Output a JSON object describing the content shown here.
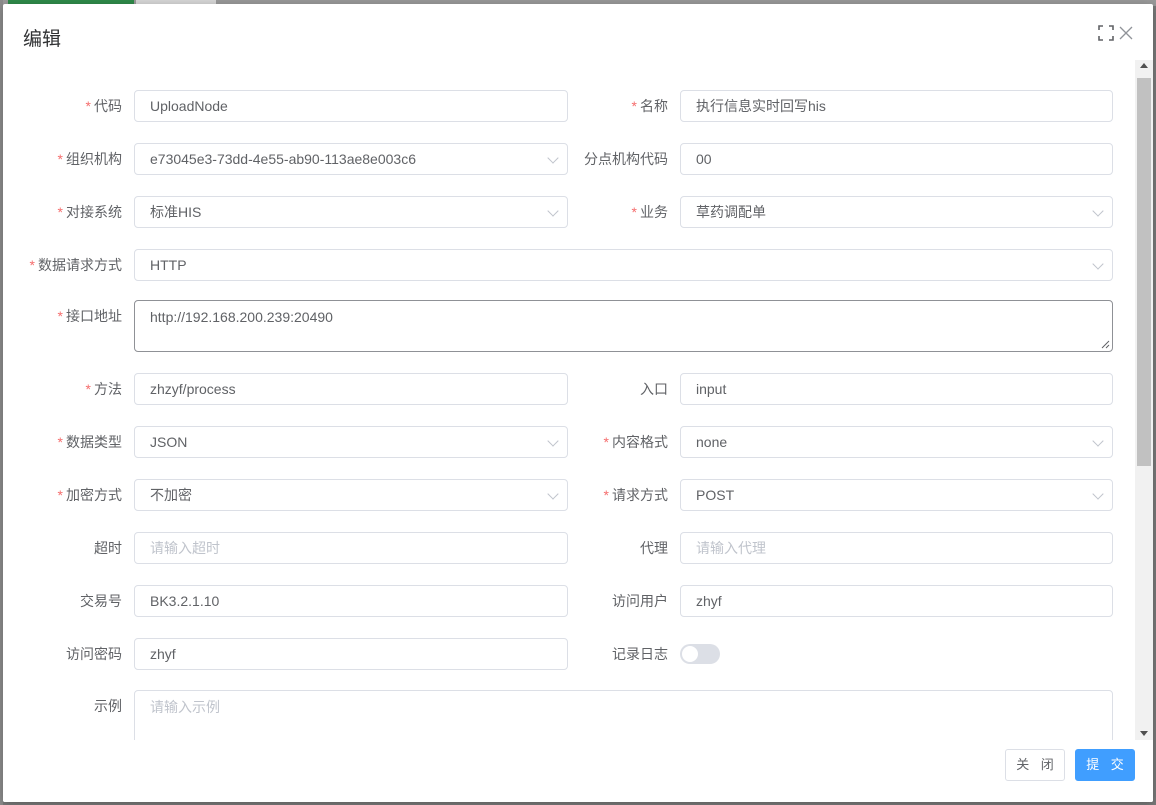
{
  "dialog": {
    "title": "编辑",
    "buttons": {
      "close": "关 闭",
      "submit": "提 交"
    }
  },
  "form": {
    "code": {
      "label": "代码",
      "value": "UploadNode"
    },
    "name": {
      "label": "名称",
      "value": "执行信息实时回写his"
    },
    "org": {
      "label": "组织机构",
      "value": "e73045e3-73dd-4e55-ab90-113ae8e003c6"
    },
    "branch_code": {
      "label": "分点机构代码",
      "value": "00"
    },
    "system": {
      "label": "对接系统",
      "value": "标准HIS"
    },
    "business": {
      "label": "业务",
      "value": "草药调配单"
    },
    "request_mode": {
      "label": "数据请求方式",
      "value": "HTTP"
    },
    "endpoint": {
      "label": "接口地址",
      "value": "http://192.168.200.239:20490"
    },
    "method": {
      "label": "方法",
      "value": "zhzyf/process"
    },
    "entry": {
      "label": "入口",
      "value": "input"
    },
    "data_type": {
      "label": "数据类型",
      "value": "JSON"
    },
    "content_format": {
      "label": "内容格式",
      "value": "none"
    },
    "encryption": {
      "label": "加密方式",
      "value": "不加密"
    },
    "request_method": {
      "label": "请求方式",
      "value": "POST"
    },
    "timeout": {
      "label": "超时",
      "placeholder": "请输入超时"
    },
    "proxy": {
      "label": "代理",
      "placeholder": "请输入代理"
    },
    "trade_no": {
      "label": "交易号",
      "value": "BK3.2.1.10"
    },
    "access_user": {
      "label": "访问用户",
      "value": "zhyf"
    },
    "access_password": {
      "label": "访问密码",
      "value": "zhyf"
    },
    "log_record": {
      "label": "记录日志",
      "enabled": false
    },
    "example": {
      "label": "示例",
      "placeholder": "请输入示例"
    }
  },
  "colors": {
    "required": "#f56c6c",
    "primary": "#409eff"
  }
}
